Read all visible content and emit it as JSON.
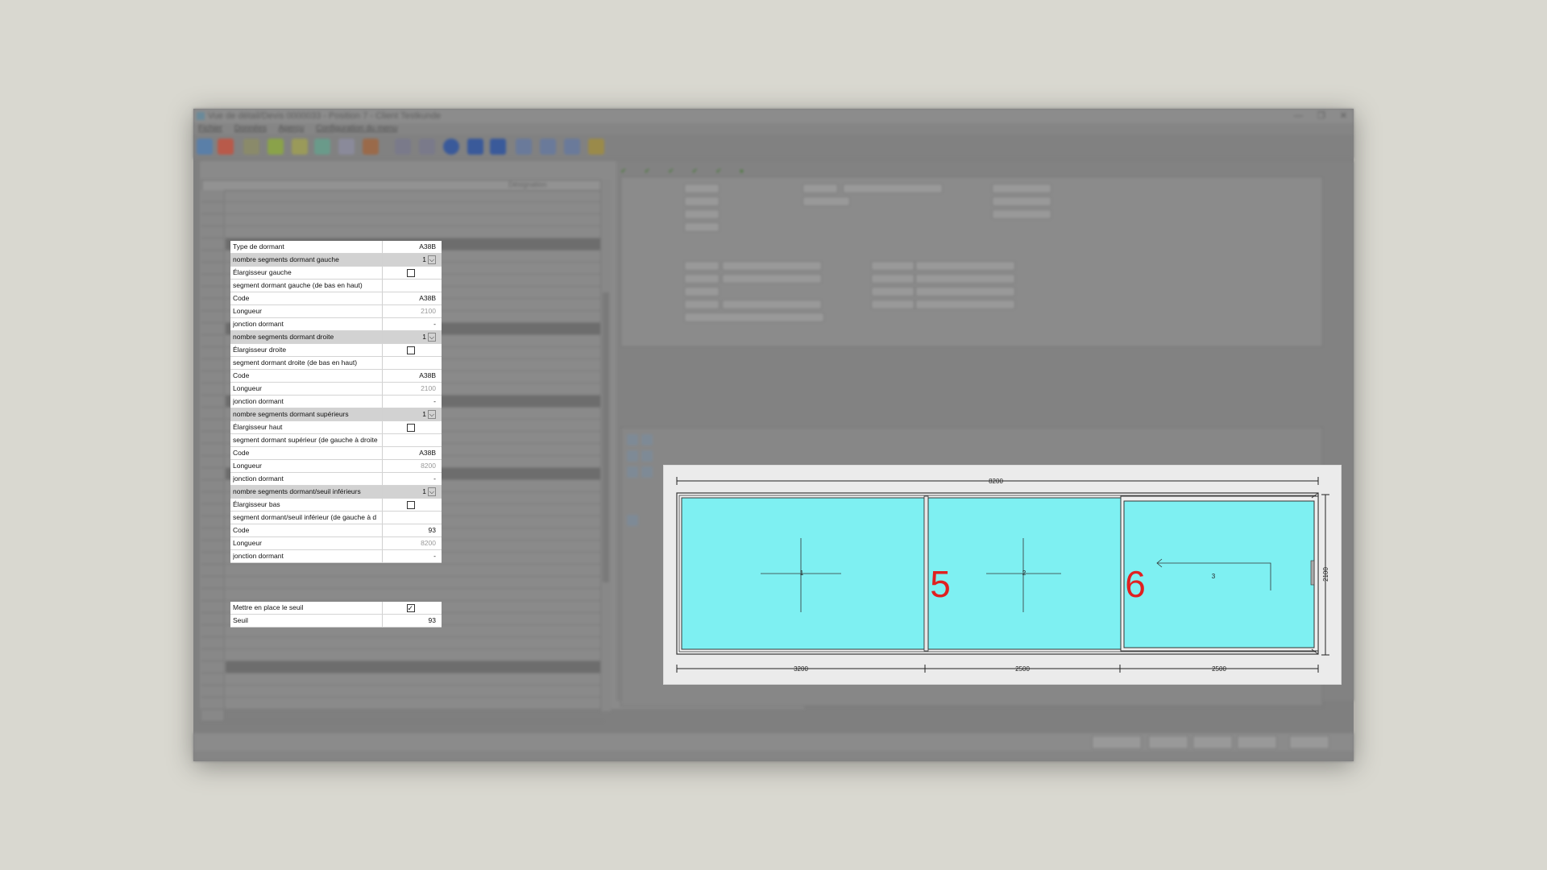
{
  "window": {
    "title": "Vue de détail/Devis 0000033 - Position 7 - Client Testkunde",
    "controls": [
      "—",
      "❐",
      "✕"
    ]
  },
  "menu": {
    "items": [
      "Fichier",
      "Données",
      "Aperçu",
      "Configuration du menu"
    ]
  },
  "grid": {
    "designation_header": "Désignation"
  },
  "properties": [
    {
      "name": "Type de dormant",
      "value": "A38B",
      "kind": "text"
    },
    {
      "name": "nombre segments dormant gauche",
      "value": "1",
      "kind": "dropdown",
      "group": true
    },
    {
      "name": "Élargisseur gauche",
      "value": false,
      "kind": "checkbox"
    },
    {
      "name": "segment dormant gauche (de bas en haut)",
      "value": "",
      "kind": "text"
    },
    {
      "name": "Code",
      "value": "A38B",
      "kind": "text"
    },
    {
      "name": "Longueur",
      "value": "2100",
      "kind": "muted"
    },
    {
      "name": "jonction dormant",
      "value": "-",
      "kind": "text"
    },
    {
      "name": "nombre segments dormant droite",
      "value": "1",
      "kind": "dropdown",
      "group": true
    },
    {
      "name": "Élargisseur droite",
      "value": false,
      "kind": "checkbox"
    },
    {
      "name": "segment dormant droite (de bas en haut)",
      "value": "",
      "kind": "text"
    },
    {
      "name": "Code",
      "value": "A38B",
      "kind": "text"
    },
    {
      "name": "Longueur",
      "value": "2100",
      "kind": "muted"
    },
    {
      "name": "jonction dormant",
      "value": "-",
      "kind": "text"
    },
    {
      "name": "nombre segments dormant supérieurs",
      "value": "1",
      "kind": "dropdown",
      "group": true
    },
    {
      "name": "Élargisseur haut",
      "value": false,
      "kind": "checkbox"
    },
    {
      "name": "segment dormant supérieur (de gauche à droite",
      "value": "",
      "kind": "text"
    },
    {
      "name": "Code",
      "value": "A38B",
      "kind": "text"
    },
    {
      "name": "Longueur",
      "value": "8200",
      "kind": "muted"
    },
    {
      "name": "jonction dormant",
      "value": "-",
      "kind": "text"
    },
    {
      "name": "nombre segments dormant/seuil inférieurs",
      "value": "1",
      "kind": "dropdown",
      "group": true
    },
    {
      "name": "Élargisseur bas",
      "value": false,
      "kind": "checkbox"
    },
    {
      "name": "segment dormant/seuil inférieur (de gauche à d",
      "value": "",
      "kind": "text"
    },
    {
      "name": "Code",
      "value": "93",
      "kind": "text"
    },
    {
      "name": "Longueur",
      "value": "8200",
      "kind": "muted"
    },
    {
      "name": "jonction dormant",
      "value": "-",
      "kind": "text"
    }
  ],
  "properties_b": [
    {
      "name": "Mettre en place le seuil",
      "value": true,
      "kind": "checkbox"
    },
    {
      "name": "Seuil",
      "value": "93",
      "kind": "text"
    }
  ],
  "drawing": {
    "overall_width": "8200",
    "height": "2100",
    "segment_widths": [
      "3200",
      "2500",
      "2500"
    ],
    "sash_labels": [
      "1",
      "2",
      "3"
    ],
    "big_labels": [
      "5",
      "6"
    ],
    "glass_color": "#7ef0f2",
    "label_color": "#e02020"
  },
  "colors": {
    "background": "#d9d8d0",
    "highlight_panel": "#ffffff",
    "group_row": "#d2d2d2"
  }
}
